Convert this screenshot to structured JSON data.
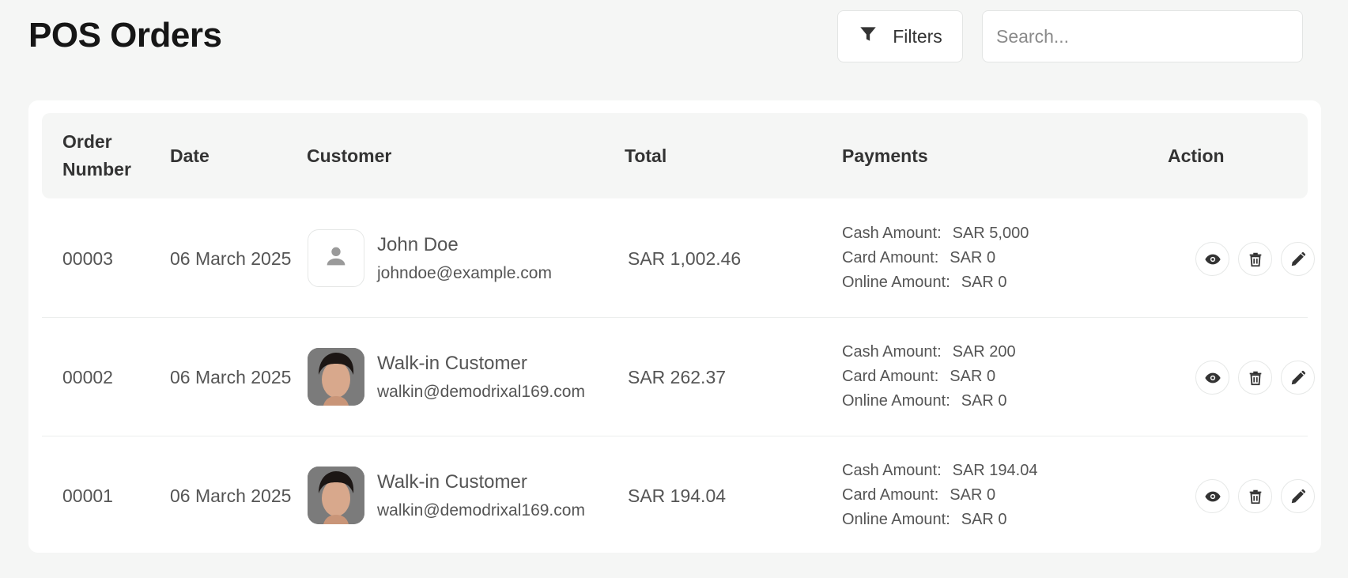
{
  "page": {
    "title": "POS Orders"
  },
  "toolbar": {
    "filters_label": "Filters",
    "search_placeholder": "Search..."
  },
  "table": {
    "headers": {
      "order_number_line1": "Order",
      "order_number_line2": "Number",
      "date": "Date",
      "customer": "Customer",
      "total": "Total",
      "payments": "Payments",
      "action": "Action"
    },
    "rows": [
      {
        "order_number": "00003",
        "date": "06 March 2025",
        "customer_name": "John Doe",
        "customer_email": "johndoe@example.com",
        "avatar": "placeholder",
        "total": "SAR 1,002.46",
        "cash_label": "Cash Amount:",
        "cash": "SAR 5,000",
        "card_label": "Card Amount:",
        "card": "SAR 0",
        "online_label": "Online Amount:",
        "online": "SAR 0"
      },
      {
        "order_number": "00002",
        "date": "06 March 2025",
        "customer_name": "Walk-in Customer",
        "customer_email": "walkin@demodrixal169.com",
        "avatar": "photo",
        "total": "SAR 262.37",
        "cash_label": "Cash Amount:",
        "cash": "SAR 200",
        "card_label": "Card Amount:",
        "card": "SAR 0",
        "online_label": "Online Amount:",
        "online": "SAR 0"
      },
      {
        "order_number": "00001",
        "date": "06 March 2025",
        "customer_name": "Walk-in Customer",
        "customer_email": "walkin@demodrixal169.com",
        "avatar": "photo",
        "total": "SAR 194.04",
        "cash_label": "Cash Amount:",
        "cash": "SAR 194.04",
        "card_label": "Card Amount:",
        "card": "SAR 0",
        "online_label": "Online Amount:",
        "online": "SAR 0"
      }
    ]
  },
  "icons": {
    "filter": "filter-icon",
    "view": "eye-icon",
    "delete": "trash-icon",
    "edit": "pencil-icon",
    "avatar_placeholder": "user-icon"
  },
  "colors": {
    "background": "#f5f6f5",
    "title": "#161616",
    "text": "#555555",
    "icon": "#333333"
  }
}
